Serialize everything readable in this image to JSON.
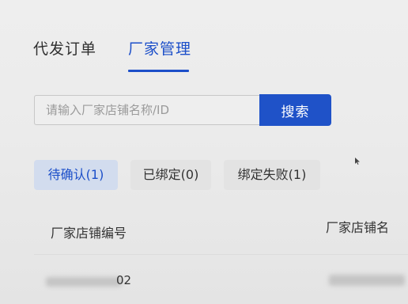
{
  "tabs": [
    {
      "label": "代发订单",
      "active": false
    },
    {
      "label": "厂家管理",
      "active": true
    }
  ],
  "search": {
    "placeholder": "请输入厂家店铺名称/ID",
    "value": "",
    "button_label": "搜索"
  },
  "filters": [
    {
      "label": "待确认(1)",
      "active": true
    },
    {
      "label": "已绑定(0)",
      "active": false
    },
    {
      "label": "绑定失败(1)",
      "active": false
    }
  ],
  "table": {
    "columns": [
      "厂家店铺编号",
      "厂家店铺名"
    ],
    "rows": [
      {
        "shop_id_visible_suffix": "02"
      }
    ]
  },
  "colors": {
    "accent": "#1f52c8",
    "active_chip_bg": "#d2dcee",
    "chip_bg": "#e3e3e3"
  }
}
